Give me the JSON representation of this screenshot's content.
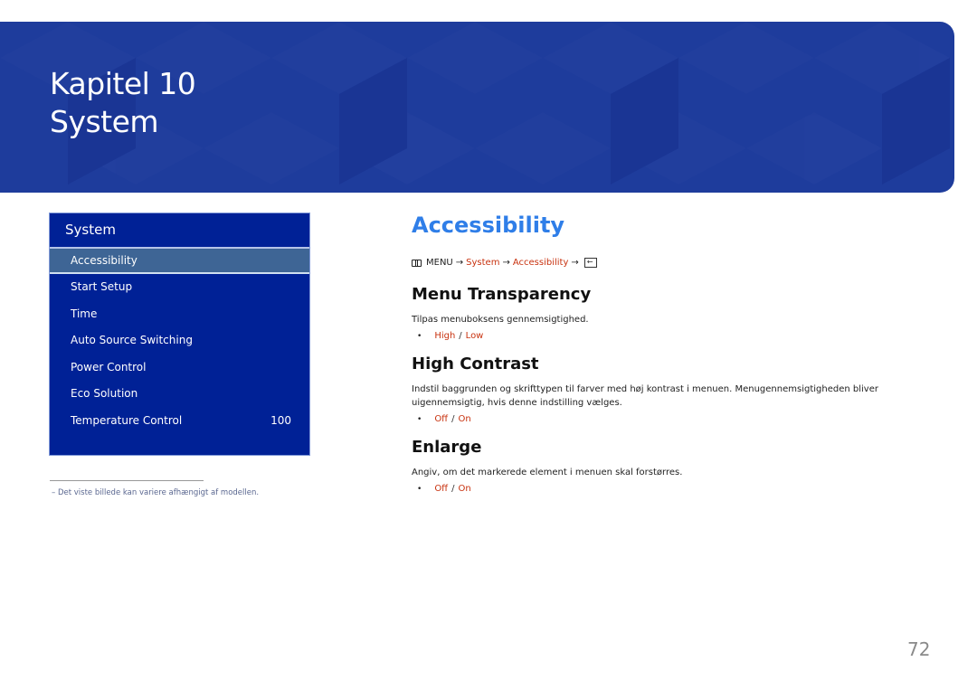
{
  "banner": {
    "chapter": "Kapitel 10",
    "title": "System"
  },
  "panel": {
    "header": "System",
    "items": [
      {
        "label": "Accessibility",
        "selected": true,
        "value": ""
      },
      {
        "label": "Start Setup",
        "value": ""
      },
      {
        "label": "Time",
        "value": ""
      },
      {
        "label": "Auto Source Switching",
        "value": ""
      },
      {
        "label": "Power Control",
        "value": ""
      },
      {
        "label": "Eco Solution",
        "value": ""
      },
      {
        "label": "Temperature Control",
        "value": "100"
      }
    ]
  },
  "footnote": "–  Det viste billede kan variere afhængigt af modellen.",
  "content": {
    "heading": "Accessibility",
    "breadcrumb": {
      "menu_icon": "menu-icon",
      "menu": "MENU",
      "arrow": "→",
      "system": "System",
      "accessibility": "Accessibility",
      "enter_icon": "enter-icon"
    },
    "sections": [
      {
        "title": "Menu Transparency",
        "description": "Tilpas menuboksens gennemsigtighed.",
        "options": [
          "High",
          "Low"
        ]
      },
      {
        "title": "High Contrast",
        "description": "Indstil baggrunden og skrifttypen til farver med høj kontrast i menuen. Menugennemsigtigheden bliver uigennemsigtig, hvis denne indstilling vælges.",
        "options": [
          "Off",
          "On"
        ]
      },
      {
        "title": "Enlarge",
        "description": "Angiv, om det markerede element i menuen skal forstørres.",
        "options": [
          "Off",
          "On"
        ]
      }
    ]
  },
  "bullet": "•",
  "separator": "/",
  "page_number": "72",
  "colors": {
    "banner": "#1e3c9c",
    "panel": "#002196",
    "selected": "#3e6595",
    "heading": "#2f7ee8",
    "option": "#c8320f"
  }
}
